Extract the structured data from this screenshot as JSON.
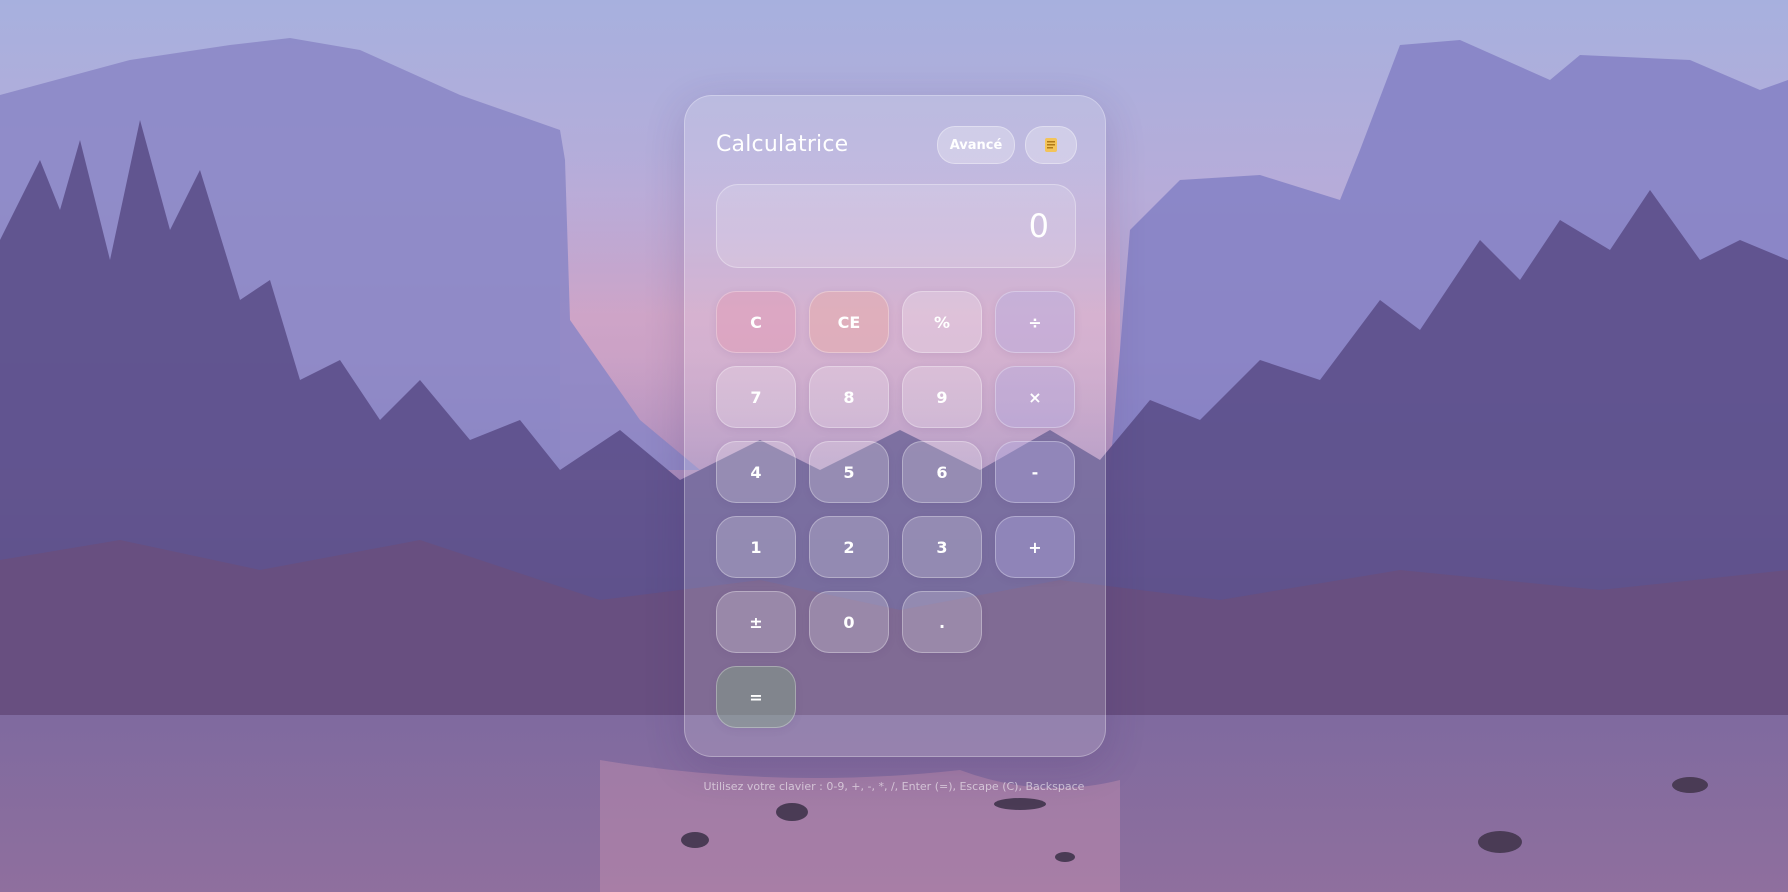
{
  "calculator": {
    "title": "Calculatrice",
    "advanced_label": "Avancé",
    "history_icon": "history-icon",
    "display_value": "0",
    "keys": {
      "clear": "C",
      "clear_entry": "CE",
      "percent": "%",
      "divide": "÷",
      "seven": "7",
      "eight": "8",
      "nine": "9",
      "multiply": "×",
      "four": "4",
      "five": "5",
      "six": "6",
      "subtract": "-",
      "one": "1",
      "two": "2",
      "three": "3",
      "add": "+",
      "plus_minus": "±",
      "zero": "0",
      "decimal": ".",
      "equals": "="
    }
  },
  "hint": "Utilisez votre clavier : 0-9, +, -, *, /, Enter (=), Escape (C), Backspace",
  "colors": {
    "sky_top": "#a7b0de",
    "sky_sunset": "#e2a6c0",
    "mountain": "#8a86c6",
    "forest": "#56497f",
    "water": "#8a6ba0"
  }
}
